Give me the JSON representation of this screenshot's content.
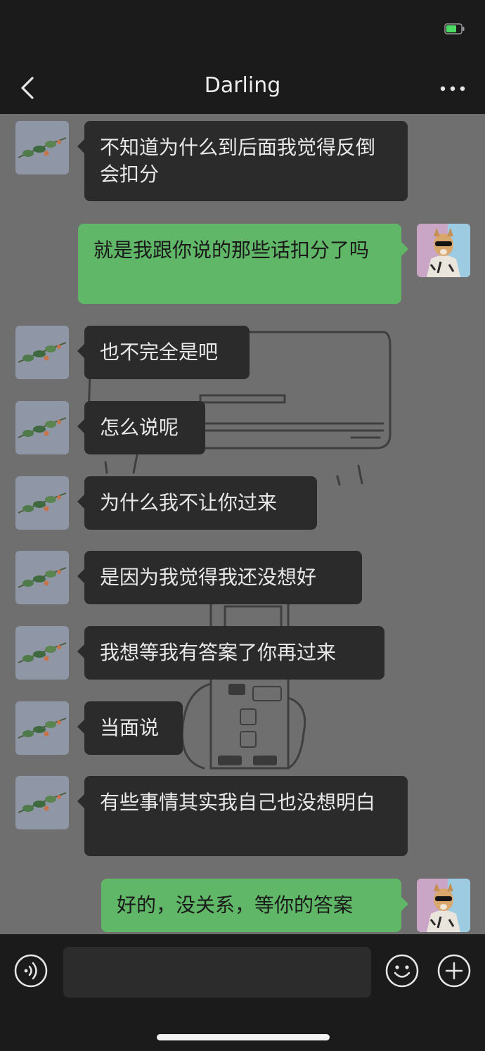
{
  "header": {
    "title": "Darling"
  },
  "icons": {
    "back": "chevron-left-icon",
    "more": "more-dots-icon",
    "battery": "battery-icon",
    "voice": "voice-icon",
    "emoji": "emoji-icon",
    "plus": "plus-icon"
  },
  "colors": {
    "incoming_bubble": "#2b2b2b",
    "outgoing_bubble": "#5fb767",
    "chat_background": "#6f6f6f",
    "bars": "#1b1b1b",
    "battery_green": "#4cd964"
  },
  "messages": [
    {
      "side": "in",
      "text": "不知道为什么到后面我觉得反倒会扣分"
    },
    {
      "side": "out",
      "text": "就是我跟你说的那些话扣分了吗"
    },
    {
      "side": "in",
      "text": "也不完全是吧"
    },
    {
      "side": "in",
      "text": "怎么说呢"
    },
    {
      "side": "in",
      "text": "为什么我不让你过来"
    },
    {
      "side": "in",
      "text": "是因为我觉得我还没想好"
    },
    {
      "side": "in",
      "text": "我想等我有答案了你再过来"
    },
    {
      "side": "in",
      "text": "当面说"
    },
    {
      "side": "in",
      "text": "有些事情其实我自己也没想明白"
    },
    {
      "side": "out",
      "text": "好的，没关系，等你的答案"
    }
  ],
  "composer": {
    "text": ""
  }
}
